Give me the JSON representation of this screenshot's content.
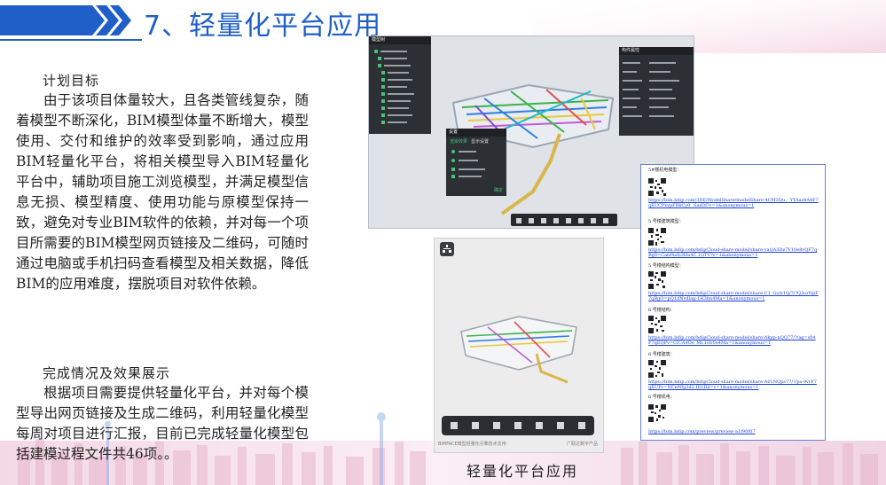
{
  "header": {
    "title": "7、轻量化平台应用"
  },
  "section1": {
    "title": "计划目标",
    "body": "由于该项目体量较大，且各类管线复杂，随着模型不断深化，BIM模型体量不断增大，模型使用、交付和维护的效率受到影响，通过应用BIM轻量化平台，将相关模型导入BIM轻量化平台中，辅助项目施工浏览模型，并满足模型信息无损、模型精度、使用功能与原模型保持一致，避免对专业BIM软件的依赖，并对每一个项目所需要的BIM模型网页链接及二维码，可随时通过电脑或手机扫码查看模型及相关数据，降低BIM的应用难度，摆脱项目对软件依赖。"
  },
  "section2": {
    "title": "完成情况及效果展示",
    "body": "根据项目需要提供轻量化平台，并对每个模型导出网页链接及生成二维码，利用轻量化模型每周对项目进行汇报，目前已完成轻量化模型包括建模过程文件共46项。。"
  },
  "caption": "轻量化平台应用",
  "links": [
    {
      "label": "5#楼机电模型：",
      "url": "https://bim.bdip.com/3DE/ModelShare/modelShare-4CM3Qu.._YYAaz8A4F7qEUCPxvpFRkCy0_.Sad3f?v=1&anonymous=1"
    },
    {
      "label": "5 号楼建筑模型：",
      "url": "https://bim.bdip.com/bdipCloud-share-model/share-vaQA3Dz7V10e8vQF7qBg0=Canf4afs3Hu4C.1GTV?v=1&anonymous=1"
    },
    {
      "label": "5 号楼结构模型：",
      "url": "https://bim.bdip.com/bdipCloud-share-model/share-C1_Gutr1Q/?/?Q3orNpF7qBgO=pQ1dNvdlag-1H3bn4Ma=1&anonymous=1"
    },
    {
      "label": "6 号楼结构：",
      "url": "https://bim.bdip.com/bdipCloud-share-model/share-Akpp-nQQ77/?/ag=s04F7qEQPv=CIUA4Oe_Mr.1Hr0e4Ma=1&anonymous=1"
    },
    {
      "label": "6 号楼建筑：",
      "url": "https://bim.bdip.com/bdipCloud-share-model/share-A01NQps77/?/ps-9vrF7qEUPv=NCnNfg3d2.ID1Bd=v=1&anonymous=1"
    },
    {
      "label": "6 号楼机电：",
      "url": "https://bim.bdip.com/preview/preview-a1f90f07"
    }
  ],
  "desktop_ui": {
    "left_panel_title": "模型树",
    "right_panel_title": "构件属性",
    "settings_title": "设置",
    "settings_tab1": "渲染效果",
    "settings_tab2": "显示设置",
    "confirm_label": "确定"
  },
  "mobile_ui": {
    "bottom_left": "BIMFACE模型轻量化引擎技术支持",
    "bottom_right": "广联达数字产品"
  }
}
